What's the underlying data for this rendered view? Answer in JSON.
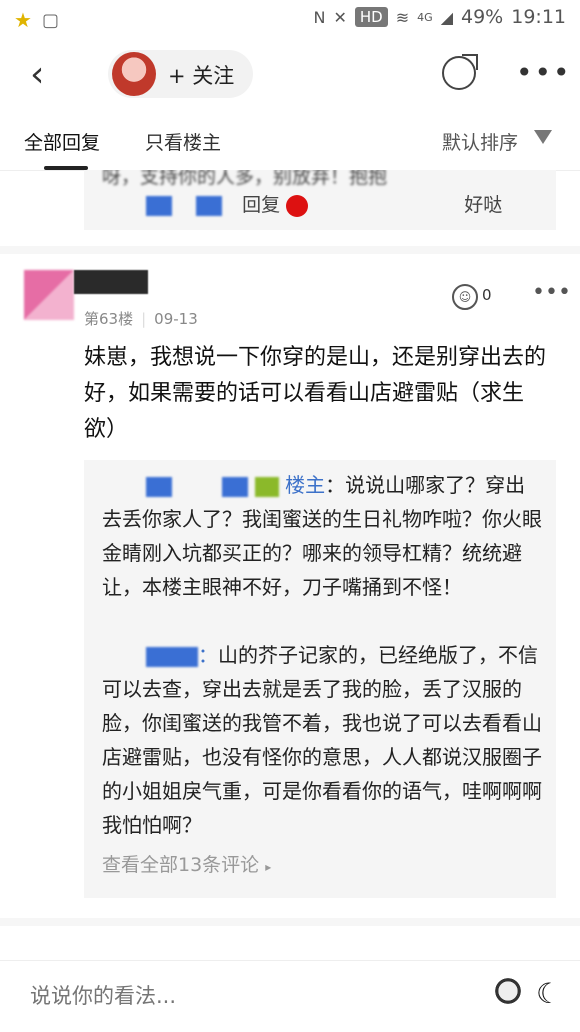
{
  "status_bar": {
    "battery": "49%",
    "time": "19:11",
    "network": "4G",
    "hd_label": "HD"
  },
  "nav": {
    "follow_label": "+ 关注"
  },
  "tabs": {
    "all_label": "全部回复",
    "host_only_label": "只看楼主",
    "sort_label": "默认排序"
  },
  "prev_reply": {
    "line1": "呀，支持你的人多，别放弃！抱抱",
    "reply_label": "回复",
    "end_text": "好哒"
  },
  "comment": {
    "floor": "第63楼",
    "date": "09-13",
    "likes": "0",
    "text": "妹崽，我想说一下你穿的是山，还是别穿出去的好，如果需要的话可以看看山店避雷贴（求生欲）"
  },
  "replies": [
    {
      "author_tag": "楼主",
      "text": "说说山哪家了？穿出去丢你家人了？我闺蜜送的生日礼物咋啦？你火眼金睛刚入坑都买正的？哪来的领导杠精？统统避让，本楼主眼神不好，刀子嘴捅到不怪！"
    },
    {
      "text": "山的芥子记家的，已经绝版了，不信可以去查，穿出去就是丢了我的脸，丢了汉服的脸，你闺蜜送的我管不着，我也说了可以去看看山店避雷贴，也没有怪你的意思，人人都说汉服圈子的小姐姐戾气重，可是你看看你的语气，哇啊啊啊我怕怕啊？"
    }
  ],
  "view_all_label": "查看全部13条评论",
  "bottom": {
    "input_placeholder": "说说你的看法..."
  },
  "colors": {
    "host_tag": "#3c71c9",
    "reply_bg": "#f5f5f5"
  }
}
